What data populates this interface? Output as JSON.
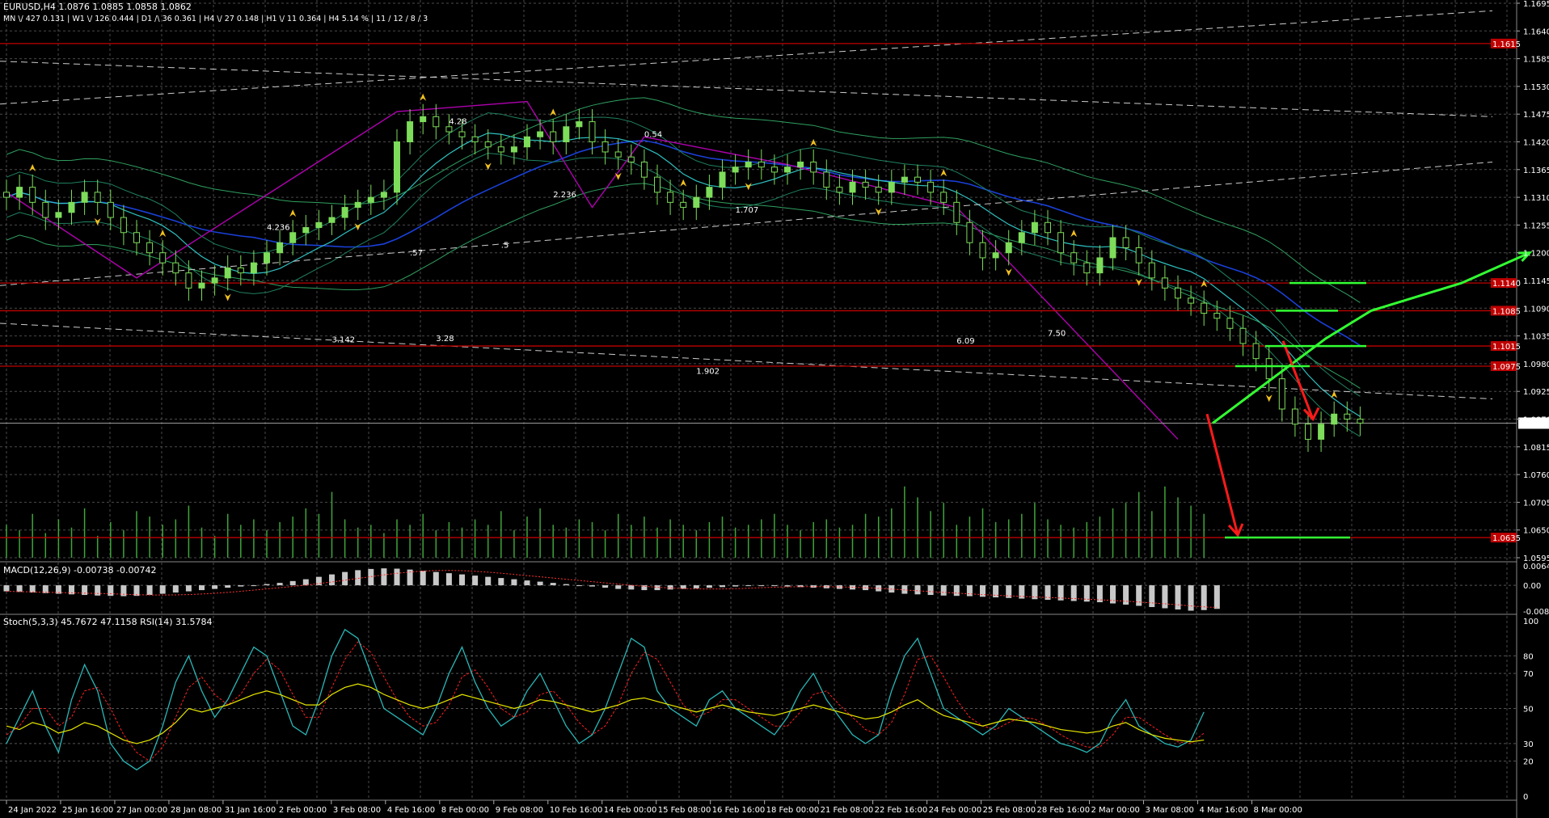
{
  "header": {
    "symbol_line": "EURUSD,H4  1.0876 1.0885 1.0858 1.0862",
    "tf_line": "MN \\/ 427   0.131  |  W1 \\/ 126   0.444  |  D1 /\\ 36   0.361  |  H4 \\/ 27   0.148  |  H1 \\/ 11   0.364  |  H4  5.14 %  |  11 / 12 / 8 / 3"
  },
  "colors": {
    "background": "#000000",
    "grid": "#4a4a4a",
    "bull_candle": "#7ddc5a",
    "bear_candle": "#b8ecb0",
    "level_line": "#c00000",
    "level_label_bg": "#c00000",
    "price_label_bg": "#ffffff",
    "bullish_forecast": "#33ff33",
    "bearish_forecast": "#ff1a1a",
    "volume": "#3fa53a",
    "macd_hist": "#c8c8c8",
    "macd_signal": "#ff3030",
    "stoch_main": "#2ab7b7",
    "stoch_signal": "#ff2020",
    "rsi": "#e8e800",
    "fractal": "#f0c020",
    "bands": "#30a060",
    "ma_blue": "#1a40d8",
    "ma_fast": "#2fc0c0",
    "zigzag": "#b000b0"
  },
  "chart_data": {
    "type": "candlestick",
    "symbol": "EURUSD",
    "timeframe": "H4",
    "ohlc_current": {
      "open": 1.0876,
      "high": 1.0885,
      "low": 1.0858,
      "close": 1.0862
    },
    "price_axis": {
      "ylim": [
        1.0595,
        1.1695
      ],
      "ticks": [
        "1.1695",
        "1.1640",
        "1.1585",
        "1.1530",
        "1.1475",
        "1.1420",
        "1.1365",
        "1.1310",
        "1.1255",
        "1.1200",
        "1.1145",
        "1.1090",
        "1.1035",
        "1.0980",
        "1.0925",
        "1.0870",
        "1.0815",
        "1.0760",
        "1.0705",
        "1.0650",
        "1.0595"
      ]
    },
    "levels": [
      {
        "price": 1.1615,
        "label": "1.1615"
      },
      {
        "price": 1.114,
        "label": "1.1140"
      },
      {
        "price": 1.1085,
        "label": "1.1085"
      },
      {
        "price": 1.1015,
        "label": "1.1015"
      },
      {
        "price": 1.0975,
        "label": "1.0975"
      },
      {
        "price": 1.0635,
        "label": "1.0635"
      }
    ],
    "current_price": {
      "price": 1.0862,
      "label": "1.0862"
    },
    "closes": [
      1.131,
      1.133,
      1.13,
      1.127,
      1.128,
      1.13,
      1.132,
      1.13,
      1.127,
      1.124,
      1.122,
      1.12,
      1.118,
      1.116,
      1.113,
      1.114,
      1.115,
      1.117,
      1.116,
      1.118,
      1.12,
      1.122,
      1.124,
      1.125,
      1.126,
      1.127,
      1.129,
      1.13,
      1.131,
      1.132,
      1.142,
      1.146,
      1.147,
      1.145,
      1.144,
      1.143,
      1.142,
      1.141,
      1.14,
      1.141,
      1.143,
      1.144,
      1.142,
      1.145,
      1.146,
      1.142,
      1.14,
      1.139,
      1.138,
      1.135,
      1.132,
      1.13,
      1.129,
      1.131,
      1.133,
      1.136,
      1.137,
      1.138,
      1.137,
      1.136,
      1.137,
      1.138,
      1.136,
      1.133,
      1.132,
      1.134,
      1.133,
      1.132,
      1.134,
      1.135,
      1.134,
      1.132,
      1.13,
      1.126,
      1.122,
      1.119,
      1.12,
      1.122,
      1.124,
      1.126,
      1.124,
      1.12,
      1.118,
      1.116,
      1.119,
      1.123,
      1.121,
      1.118,
      1.115,
      1.113,
      1.111,
      1.11,
      1.108,
      1.107,
      1.105,
      1.102,
      1.099,
      1.095,
      1.089,
      1.086,
      1.083,
      1.086,
      1.088,
      1.087,
      1.0862
    ],
    "dates": [
      {
        "label": "24 Jan 2022",
        "index": 0
      },
      {
        "label": "25 Jan 16:00",
        "index": 4
      },
      {
        "label": "27 Jan 00:00",
        "index": 8
      },
      {
        "label": "28 Jan 08:00",
        "index": 12
      },
      {
        "label": "31 Jan 16:00",
        "index": 16
      },
      {
        "label": "2 Feb 00:00",
        "index": 20
      },
      {
        "label": "3 Feb 08:00",
        "index": 24
      },
      {
        "label": "4 Feb 16:00",
        "index": 28
      },
      {
        "label": "8 Feb 00:00",
        "index": 32
      },
      {
        "label": "9 Feb 08:00",
        "index": 36
      },
      {
        "label": "10 Feb 16:00",
        "index": 40
      },
      {
        "label": "14 Feb 00:00",
        "index": 44
      },
      {
        "label": "15 Feb 08:00",
        "index": 48
      },
      {
        "label": "16 Feb 16:00",
        "index": 52
      },
      {
        "label": "18 Feb 00:00",
        "index": 56
      },
      {
        "label": "21 Feb 08:00",
        "index": 60
      },
      {
        "label": "22 Feb 16:00",
        "index": 64
      },
      {
        "label": "24 Feb 00:00",
        "index": 68
      },
      {
        "label": "25 Feb 08:00",
        "index": 72
      },
      {
        "label": "28 Feb 16:00",
        "index": 76
      },
      {
        "label": "2 Mar 00:00",
        "index": 80
      },
      {
        "label": "3 Mar 08:00",
        "index": 84
      },
      {
        "label": "4 Mar 16:00",
        "index": 88
      },
      {
        "label": "8 Mar 00:00",
        "index": 92
      }
    ],
    "fib_labels": [
      {
        "text": "1.902",
        "index": 53,
        "price": 1.096
      },
      {
        "text": "3.142",
        "index": 25,
        "price": 1.1022
      },
      {
        "text": "3.28",
        "index": 33,
        "price": 1.1025
      },
      {
        "text": "2.236",
        "index": 42,
        "price": 1.131
      },
      {
        "text": "0.54",
        "index": 49,
        "price": 1.143
      },
      {
        "text": ".5",
        "index": 38,
        "price": 1.121
      },
      {
        "text": ".57",
        "index": 31,
        "price": 1.1195
      },
      {
        "text": "7.50",
        "index": 80,
        "price": 1.1035
      },
      {
        "text": "6.09",
        "index": 73,
        "price": 1.102
      },
      {
        "text": "4.28",
        "index": 34,
        "price": 1.1455
      },
      {
        "text": "4.236",
        "index": 20,
        "price": 1.1245
      },
      {
        "text": "1.707",
        "index": 56,
        "price": 1.128
      }
    ],
    "forecast": {
      "bullish_path": [
        [
          1.0862,
          0
        ],
        [
          1.103,
          1
        ],
        [
          1.1085,
          1.4
        ],
        [
          1.114,
          2.2
        ],
        [
          1.12,
          2.8
        ]
      ],
      "bearish_path_long": [
        [
          1.088,
          0
        ],
        [
          1.064,
          1
        ]
      ],
      "bearish_path_short": [
        [
          1.1025,
          0
        ],
        [
          1.087,
          1
        ]
      ]
    },
    "volumes": [
      60,
      50,
      80,
      45,
      70,
      55,
      90,
      40,
      65,
      50,
      85,
      75,
      60,
      70,
      95,
      55,
      40,
      80,
      60,
      70,
      50,
      65,
      75,
      90,
      80,
      120,
      70,
      55,
      60,
      45,
      70,
      60,
      80,
      50,
      65,
      55,
      70,
      60,
      85,
      50,
      75,
      90,
      60,
      55,
      70,
      65,
      50,
      80,
      60,
      75,
      55,
      70,
      60,
      50,
      65,
      75,
      55,
      60,
      70,
      80,
      60,
      50,
      65,
      70,
      55,
      60,
      80,
      75,
      90,
      130,
      110,
      85,
      100,
      60,
      75,
      90,
      65,
      70,
      80,
      100,
      70,
      60,
      55,
      65,
      75,
      90,
      100,
      120,
      85,
      130,
      110,
      95,
      80
    ],
    "macd": {
      "title": "MACD(12,26,9) -0.00738 -0.00742",
      "ticks": [
        "0.00644",
        "0.00",
        "-0.00853"
      ],
      "hist": [
        -0.002,
        -0.0022,
        -0.0024,
        -0.0026,
        -0.0028,
        -0.003,
        -0.0032,
        -0.0034,
        -0.0035,
        -0.0036,
        -0.0035,
        -0.0032,
        -0.0028,
        -0.0024,
        -0.002,
        -0.0016,
        -0.0012,
        -0.0008,
        -0.0004,
        0.0,
        0.0004,
        0.0008,
        0.0014,
        0.002,
        0.0028,
        0.0036,
        0.0044,
        0.005,
        0.0054,
        0.0056,
        0.0055,
        0.0052,
        0.0048,
        0.0044,
        0.004,
        0.0036,
        0.0032,
        0.0028,
        0.0024,
        0.002,
        0.0016,
        0.0012,
        0.0008,
        0.0004,
        0.0,
        -0.0004,
        -0.0008,
        -0.0012,
        -0.0014,
        -0.0016,
        -0.0016,
        -0.0014,
        -0.0012,
        -0.001,
        -0.0008,
        -0.0006,
        -0.0004,
        -0.0002,
        0.0,
        -0.0002,
        -0.0004,
        -0.0006,
        -0.0008,
        -0.001,
        -0.0012,
        -0.0014,
        -0.0016,
        -0.002,
        -0.0024,
        -0.0028,
        -0.003,
        -0.0032,
        -0.0034,
        -0.0035,
        -0.0036,
        -0.0038,
        -0.004,
        -0.0042,
        -0.0044,
        -0.0046,
        -0.0048,
        -0.005,
        -0.0052,
        -0.0054,
        -0.0056,
        -0.006,
        -0.0064,
        -0.0068,
        -0.0072,
        -0.0076,
        -0.008,
        -0.0084,
        -0.0082,
        -0.0078
      ]
    },
    "stoch": {
      "title": "Stoch(5,3,3) 45.7672 47.1158  RSI(14) 31.5784",
      "ticks": [
        "100",
        "80",
        "70",
        "50",
        "30",
        "20",
        "0"
      ],
      "k": [
        30,
        45,
        60,
        40,
        25,
        55,
        75,
        60,
        30,
        20,
        15,
        20,
        40,
        65,
        80,
        60,
        45,
        55,
        70,
        85,
        80,
        60,
        40,
        35,
        55,
        80,
        95,
        90,
        70,
        50,
        45,
        40,
        35,
        50,
        70,
        85,
        65,
        50,
        40,
        45,
        60,
        70,
        55,
        40,
        30,
        35,
        50,
        70,
        90,
        85,
        60,
        50,
        45,
        40,
        55,
        60,
        50,
        45,
        40,
        35,
        45,
        60,
        70,
        55,
        45,
        35,
        30,
        35,
        60,
        80,
        90,
        70,
        50,
        45,
        40,
        35,
        40,
        50,
        45,
        40,
        35,
        30,
        28,
        25,
        30,
        45,
        55,
        40,
        35,
        30,
        28,
        32,
        48
      ],
      "d": [
        35,
        40,
        50,
        50,
        40,
        45,
        60,
        62,
        50,
        35,
        25,
        20,
        28,
        45,
        62,
        68,
        58,
        52,
        58,
        70,
        78,
        72,
        58,
        45,
        45,
        62,
        78,
        88,
        82,
        68,
        55,
        45,
        40,
        42,
        52,
        68,
        72,
        62,
        50,
        45,
        48,
        58,
        60,
        52,
        42,
        35,
        40,
        52,
        70,
        82,
        78,
        65,
        52,
        45,
        48,
        55,
        55,
        50,
        45,
        40,
        40,
        48,
        58,
        60,
        52,
        45,
        38,
        35,
        42,
        58,
        78,
        80,
        68,
        55,
        45,
        40,
        38,
        42,
        45,
        44,
        40,
        35,
        31,
        28,
        28,
        35,
        45,
        45,
        40,
        35,
        31,
        30,
        36
      ],
      "rsi": [
        40,
        38,
        42,
        40,
        36,
        38,
        42,
        40,
        36,
        32,
        30,
        32,
        36,
        42,
        50,
        48,
        50,
        52,
        55,
        58,
        60,
        58,
        55,
        52,
        52,
        58,
        62,
        64,
        62,
        58,
        55,
        52,
        50,
        52,
        55,
        58,
        56,
        54,
        52,
        50,
        52,
        55,
        54,
        52,
        50,
        48,
        50,
        52,
        55,
        56,
        54,
        52,
        50,
        48,
        50,
        52,
        50,
        48,
        47,
        46,
        48,
        50,
        52,
        50,
        48,
        46,
        44,
        45,
        48,
        52,
        55,
        50,
        46,
        44,
        42,
        40,
        42,
        44,
        43,
        42,
        40,
        38,
        37,
        36,
        37,
        40,
        42,
        38,
        35,
        33,
        32,
        31,
        32
      ]
    }
  }
}
